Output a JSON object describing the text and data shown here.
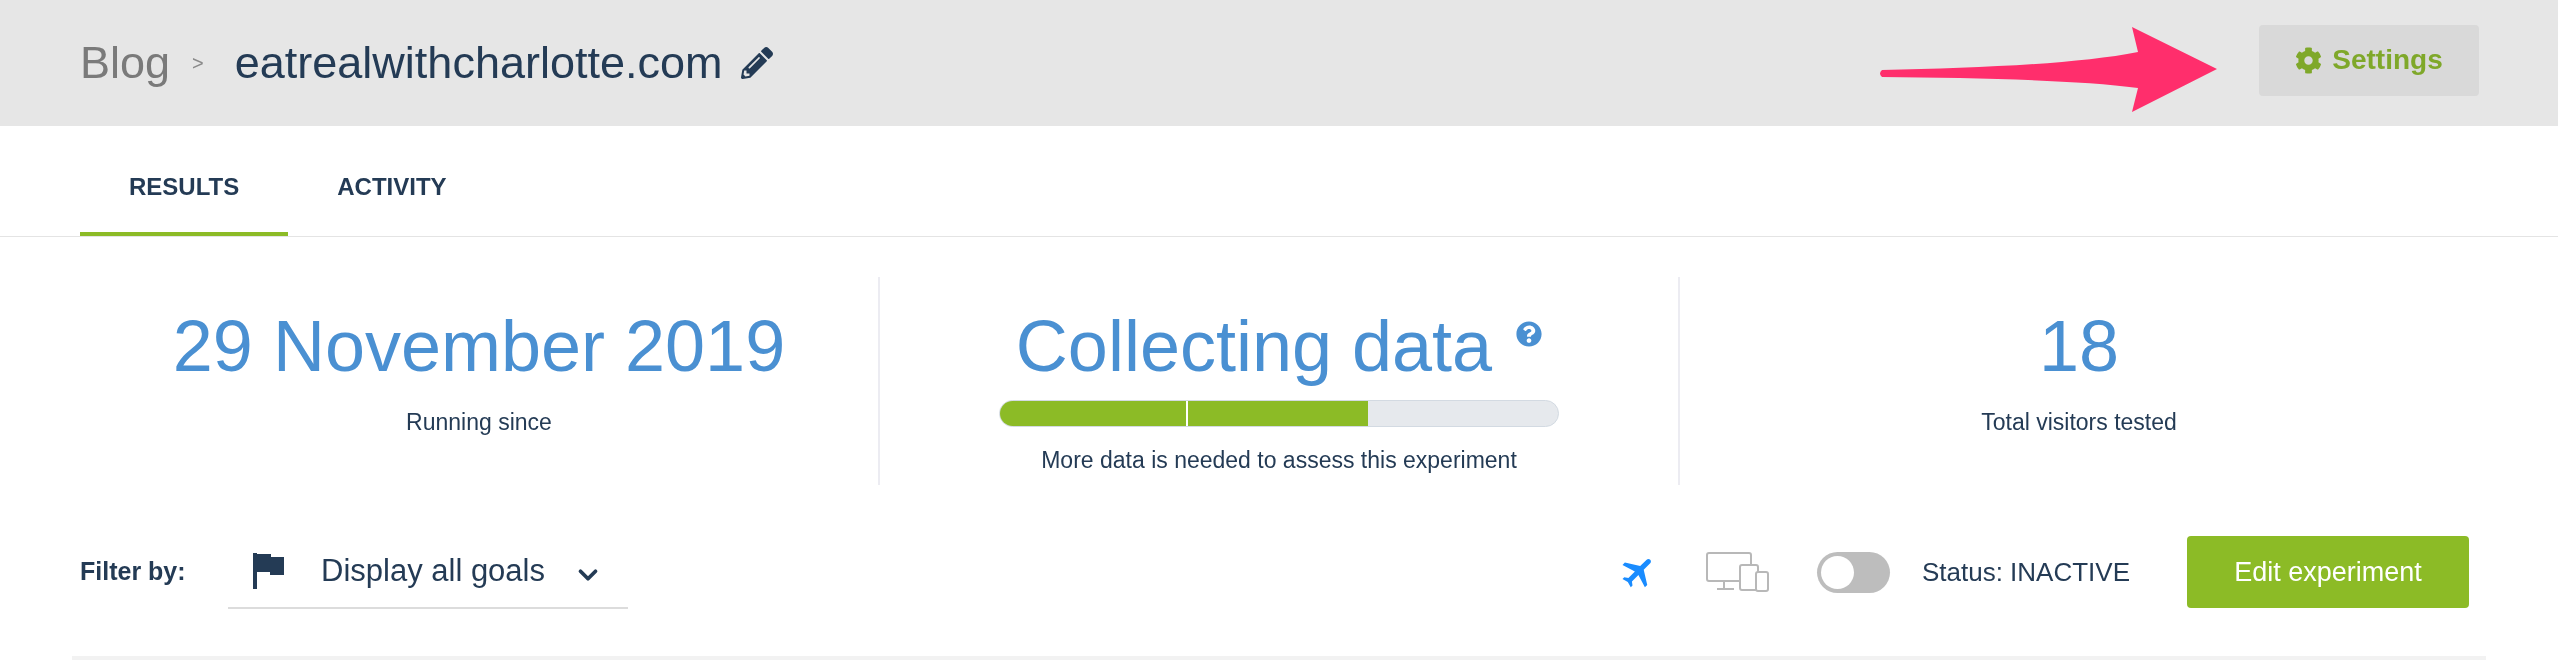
{
  "header": {
    "breadcrumb": {
      "parent": "Blog",
      "separator": ">",
      "current": "eatrealwithcharlotte.com"
    },
    "settings_button": "Settings"
  },
  "tabs": [
    {
      "label": "RESULTS",
      "selected": true
    },
    {
      "label": "ACTIVITY",
      "selected": false
    }
  ],
  "stats": [
    {
      "kind": "text",
      "value": "29 November 2019",
      "label": "Running since"
    },
    {
      "kind": "progress",
      "value": "Collecting data",
      "level": 0.66,
      "label": "More data is needed to assess this experiment"
    },
    {
      "kind": "text",
      "value": "18",
      "label": "Total visitors tested"
    }
  ],
  "filter": {
    "label": "Filter by:",
    "value": "Display all goals"
  },
  "toolbar": {
    "views": [
      {
        "kind": "plane",
        "selected": true
      },
      {
        "kind": "devices",
        "selected": false
      }
    ],
    "toggle": {
      "on": false
    },
    "status": "Status: INACTIVE",
    "edit_button": "Edit experiment"
  }
}
